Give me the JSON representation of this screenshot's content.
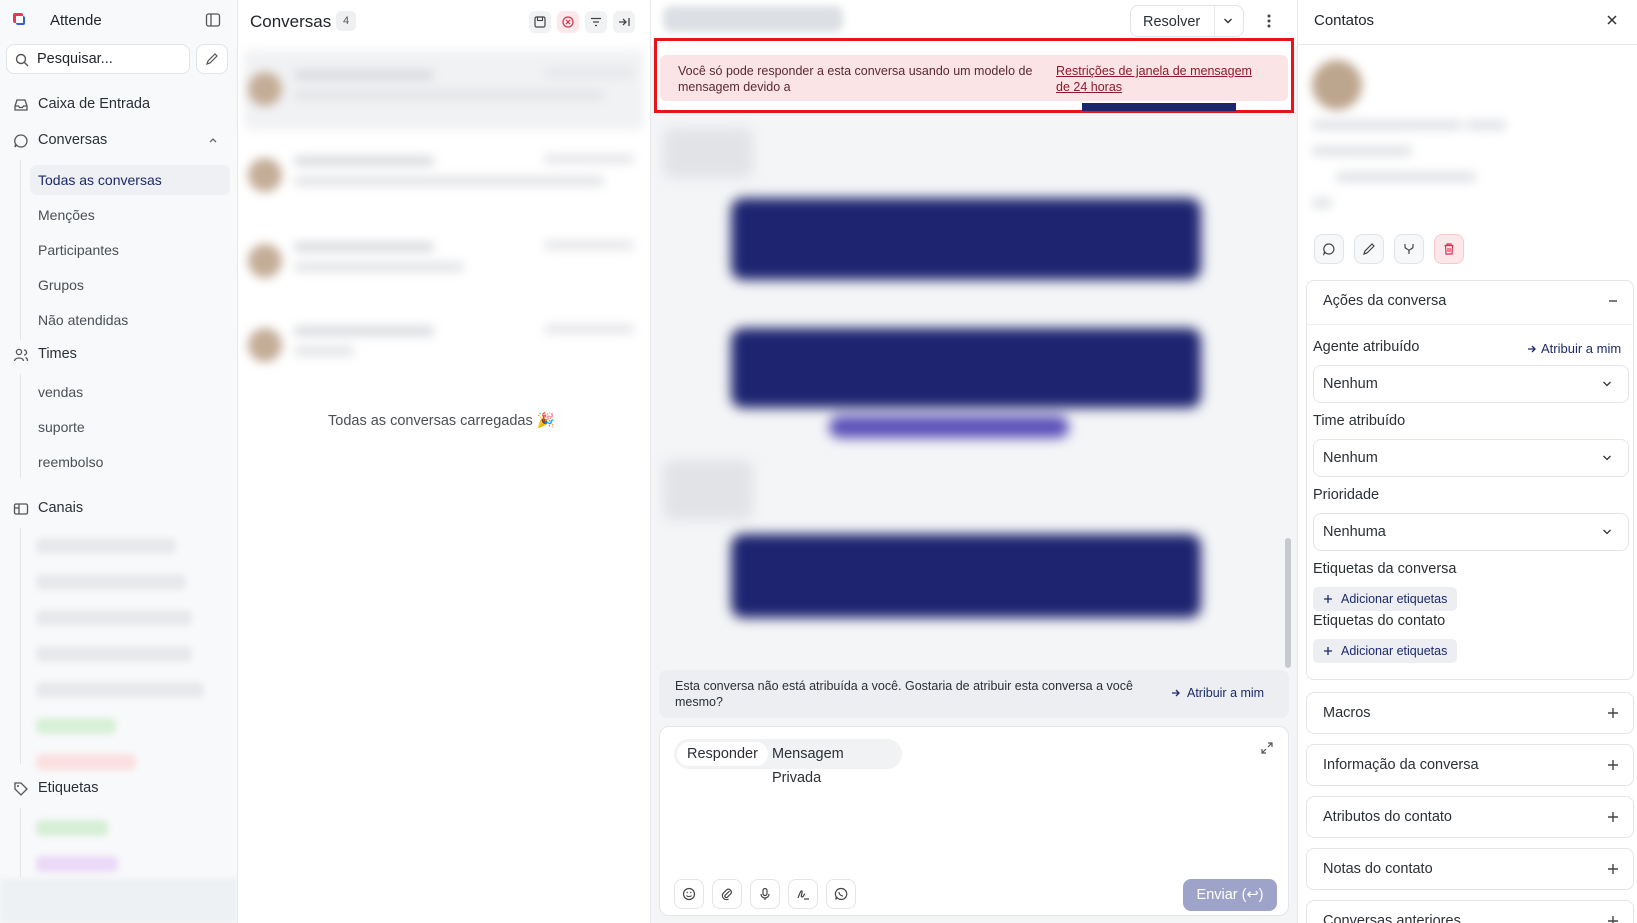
{
  "app": {
    "name": "Attende"
  },
  "sidebar": {
    "search_placeholder": "Pesquisar...",
    "inbox": "Caixa de Entrada",
    "conversations": "Conversas",
    "conversation_items": [
      "Todas as conversas",
      "Menções",
      "Participantes",
      "Grupos",
      "Não atendidas"
    ],
    "teams": "Times",
    "team_items": [
      "vendas",
      "suporte",
      "reembolso"
    ],
    "channels": "Canais",
    "labels": "Etiquetas"
  },
  "conversation_list": {
    "title": "Conversas",
    "count": "4",
    "all_loaded": "Todas as conversas carregadas 🎉"
  },
  "chat": {
    "resolve_label": "Resolver",
    "banner_message": "Você só pode responder a esta conversa usando um modelo de mensagem devido a",
    "banner_link": "Restrições de janela de mensagem de 24 horas",
    "assign_message": "Esta conversa não está atribuída a você. Gostaria de atribuir esta conversa a você mesmo?",
    "assign_action": "Atribuir a mim",
    "reply_mode": "Responder",
    "private_mode": "Mensagem Privada",
    "send_label": "Enviar (↩)"
  },
  "contacts_panel": {
    "title": "Contatos",
    "actions_header": "Ações da conversa",
    "agent_label": "Agente atribuído",
    "agent_action": "Atribuir a mim",
    "agent_value": "Nenhum",
    "team_label": "Time atribuído",
    "team_value": "Nenhum",
    "priority_label": "Prioridade",
    "priority_value": "Nenhuma",
    "conv_labels_label": "Etiquetas da conversa",
    "add_labels": "Adicionar etiquetas",
    "contact_labels_label": "Etiquetas do contato",
    "add_labels_2": "Adicionar etiquetas",
    "sections": [
      "Macros",
      "Informação da conversa",
      "Atributos do contato",
      "Notas do contato",
      "Conversas anteriores"
    ]
  },
  "colors": {
    "accent": "#1c2a6b",
    "highlight_border": "#e8141c",
    "banner_bg": "#fbe4e6",
    "send_disabled": "#9ea3c9"
  },
  "icons": [
    "logo-icon",
    "panel-toggle-icon",
    "search-icon",
    "compose-icon",
    "inbox-icon",
    "chat-icon",
    "users-icon",
    "channels-icon",
    "tag-icon",
    "close-icon",
    "plus-icon",
    "minus-icon",
    "chevron-down-icon",
    "arrow-right-icon"
  ]
}
